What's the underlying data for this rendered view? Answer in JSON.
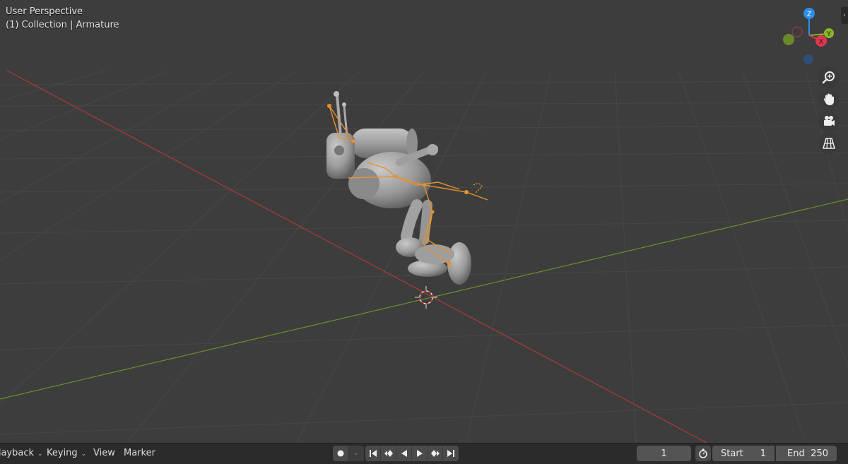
{
  "viewport": {
    "view_name": "User Perspective",
    "context": "(1) Collection | Armature"
  },
  "gizmo": {
    "axis_z": "Z",
    "axis_y": "Y",
    "axis_x": "X",
    "color_x": "#e0364f",
    "color_y": "#8ab624",
    "color_z": "#2c8fea"
  },
  "nav_buttons": [
    "zoom-icon",
    "hand-pan-icon",
    "camera-icon",
    "grid-ortho-icon"
  ],
  "timeline": {
    "playback_label": "Playback",
    "keying_label": "Keying",
    "view_label": "View",
    "marker_label": "Marker",
    "current_frame": "1",
    "start_label": "Start",
    "start_value": "1",
    "end_label": "End",
    "end_value": "250"
  },
  "colors": {
    "accent_orange": "#e8912f",
    "background": "#3d3d3d"
  }
}
